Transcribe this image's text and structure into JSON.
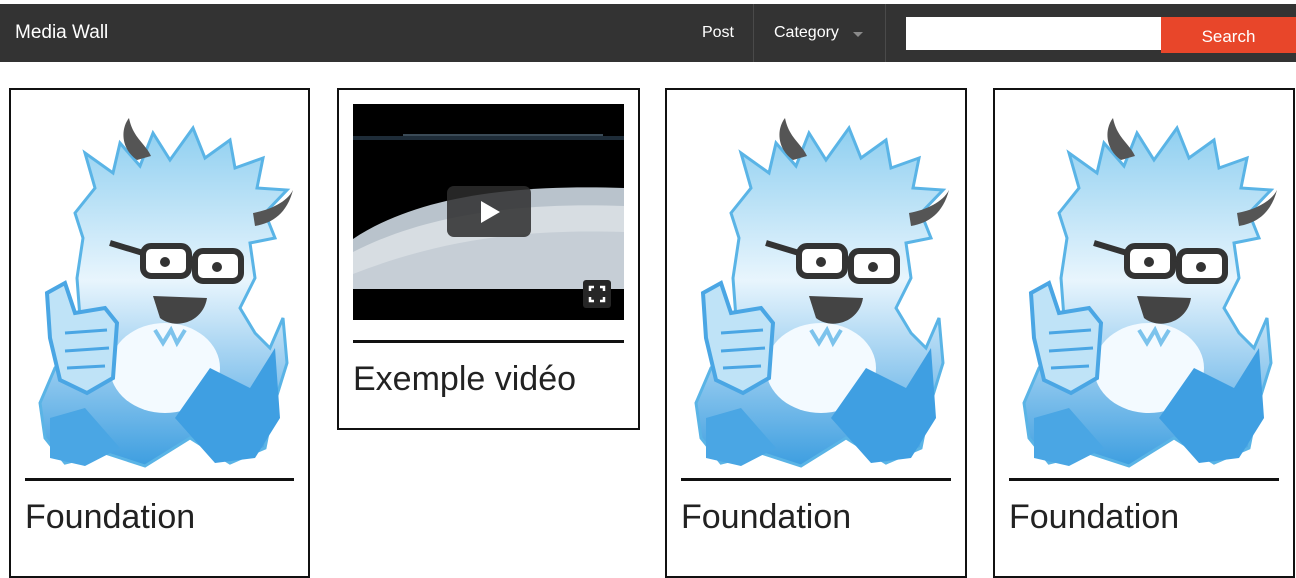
{
  "header": {
    "brand": "Media Wall",
    "nav": {
      "post_label": "Post",
      "category_label": "Category"
    },
    "search": {
      "value": "",
      "placeholder": "",
      "button_label": "Search"
    }
  },
  "cards": [
    {
      "caption": "Foundation",
      "media": "yeti-illustration"
    },
    {
      "caption": "Exemple vidéo",
      "media": "video-player"
    },
    {
      "caption": "Foundation",
      "media": "yeti-illustration"
    },
    {
      "caption": "Foundation",
      "media": "yeti-illustration"
    }
  ],
  "colors": {
    "topbar": "#333333",
    "search_button": "#e8462a",
    "yeti_light": "#e6f4fc",
    "yeti_mid": "#9fd6f2",
    "yeti_dark": "#2c8ed6",
    "card_border": "#111111"
  },
  "icons": [
    "caret-down-icon",
    "play-icon",
    "fullscreen-icon",
    "yeti-mascot-image"
  ]
}
